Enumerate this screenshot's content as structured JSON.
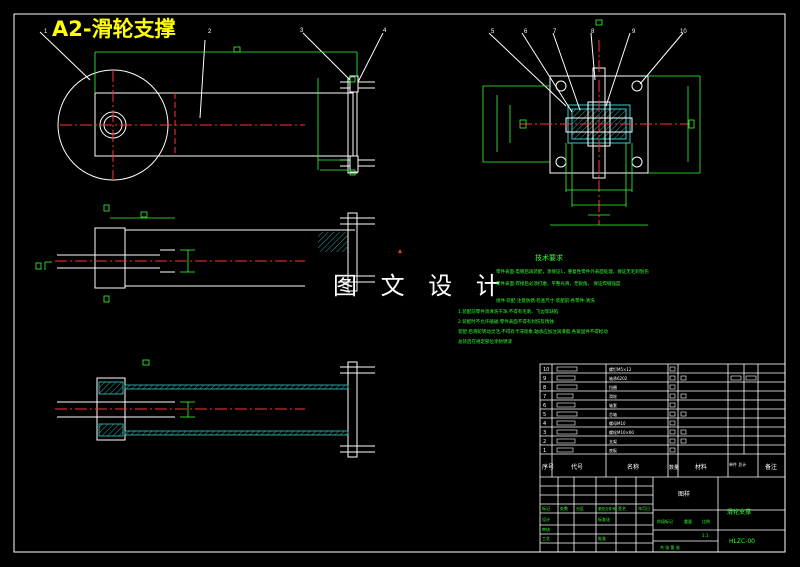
{
  "drawing": {
    "title": "A2-滑轮支撑",
    "watermark": "图 文 设 计",
    "part_numbers": [
      "1",
      "2",
      "3",
      "4",
      "5",
      "6",
      "7",
      "8",
      "9",
      "10"
    ]
  },
  "tech_req": {
    "heading": "技术要求",
    "lines": [
      "零件表面·电镀后再装配，须保证1，重复性零件外表面处理，保证无毛刺划伤",
      "零件表面·焊接后必须打磨，平整光滑，无锐角，  保证焊缝强度",
      "",
      "组件·装配·注意防锈·检查尺寸·装配前·各零件·清洗",
      "1.装配前零件须清洗干净,不得有毛刺、飞边等缺陷",
      "2.装配时不允许磕碰,零件表面不得有划伤及锈蚀",
      "装配   后滑轮转动灵活,不得有卡滞现象,轴承应加注润滑脂,各紧固件不得松动",
      "总装后在规定部位涂防锈漆"
    ]
  },
  "title_block": {
    "header": {
      "no": "序号",
      "code": "代号",
      "name": "名称",
      "qty": "数量",
      "material": "材料",
      "weight": "单件 总计",
      "note": "备注"
    },
    "rows": [
      {
        "no": "10",
        "name": "螺钉M5×12"
      },
      {
        "no": "9",
        "name": "轴承6202"
      },
      {
        "no": "8",
        "name": "挡圈"
      },
      {
        "no": "7",
        "name": "滑轮"
      },
      {
        "no": "6",
        "name": "轴套"
      },
      {
        "no": "5",
        "name": "芯轴"
      },
      {
        "no": "4",
        "name": "螺母M10"
      },
      {
        "no": "3",
        "name": "螺栓M10×60"
      },
      {
        "no": "2",
        "name": "支架"
      },
      {
        "no": "1",
        "name": "底板"
      }
    ],
    "assembly_name": "滑轮支撑",
    "drawing_code": "HLZC-00",
    "unit_label": "图样",
    "sign_labels": [
      "标记",
      "处数",
      "分区",
      "更改文件号",
      "签名",
      "年月日"
    ],
    "role_labels": [
      "设计",
      "标准化",
      "审核",
      "工艺",
      "批准"
    ],
    "stage_labels": [
      "阶段标记",
      "重量",
      "比例"
    ],
    "sheet_label": "共 张 第 张",
    "scale_value": "1:1"
  },
  "colors": {
    "background": "#000000",
    "outline": "#ffffff",
    "dimension": "#33ff33",
    "center_line": "#ff3333",
    "hatch": "#33cccc",
    "title": "#ffff00"
  }
}
